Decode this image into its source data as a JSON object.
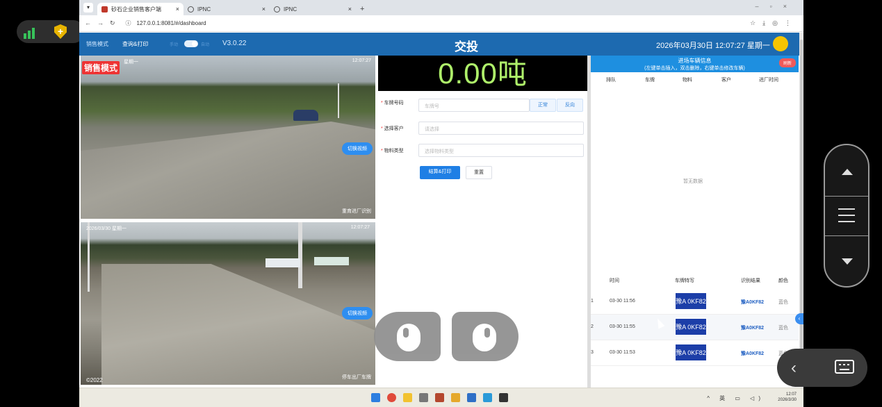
{
  "browser": {
    "tabs": [
      {
        "title": "砂石企业销售客户端",
        "active": true
      },
      {
        "title": "IPNC",
        "active": false
      },
      {
        "title": "IPNC",
        "active": false
      }
    ],
    "new_tab": "+",
    "url": "127.0.0.1:8081/#/dashboard"
  },
  "header": {
    "menu_sales": "销售模式",
    "menu_query": "查询&打印",
    "switch_left": "手动",
    "switch_right": "自动",
    "version": "V3.0.22",
    "title": "交投",
    "datetime": "2026年03月30日 12:07:27 星期一"
  },
  "cameras": [
    {
      "badge": "销售模式",
      "timestamp_left": "星期一",
      "timestamp_right": "12:07:27",
      "button": "切换视频",
      "label": "重育进厂识别"
    },
    {
      "timestamp_left": "2026/03/30 星期一",
      "timestamp_right": "12:07:27",
      "button": "切换视频",
      "label": "停车出厂车牌",
      "watermark": "©2022"
    }
  ],
  "form": {
    "weight": "0.00吨",
    "plate_label": "车牌号码",
    "plate_placeholder": "车牌号",
    "btn_forward": "正常",
    "btn_reverse": "反向",
    "customer_label": "选择客户",
    "customer_placeholder": "请选择",
    "material_label": "物料类型",
    "material_placeholder": "选择物料类型",
    "btn_submit": "结算&打印",
    "btn_reset": "重置"
  },
  "queue": {
    "title": "进场车辆信息",
    "subtitle": "(左键单击插入，双击删除，右键单击修改车辆)",
    "refresh": "刷新",
    "columns": [
      "排队",
      "车牌",
      "物料",
      "客户",
      "进厂时间"
    ],
    "empty": "暂无数据"
  },
  "recognition": {
    "columns": [
      "时间",
      "车牌特写",
      "识别结果",
      "颜色"
    ],
    "rows": [
      {
        "index": "1",
        "time": "03-30 11:56",
        "plate_img": "豫A 0KF82",
        "result": "豫A0KF82",
        "color": "蓝色"
      },
      {
        "index": "2",
        "time": "03-30 11:55",
        "plate_img": "豫A 0KF82",
        "result": "豫A0KF82",
        "color": "蓝色"
      },
      {
        "index": "3",
        "time": "03-30 11:53",
        "plate_img": "豫A 0KF82",
        "result": "豫A0KF82",
        "color": "蓝色"
      }
    ]
  },
  "taskbar": {
    "lang": "英",
    "time": "12:07",
    "date": "2026/3/30"
  },
  "colors": {
    "header_blue": "#1d6ab0",
    "weight_green": "#aef06a",
    "primary": "#1f7fe5"
  }
}
